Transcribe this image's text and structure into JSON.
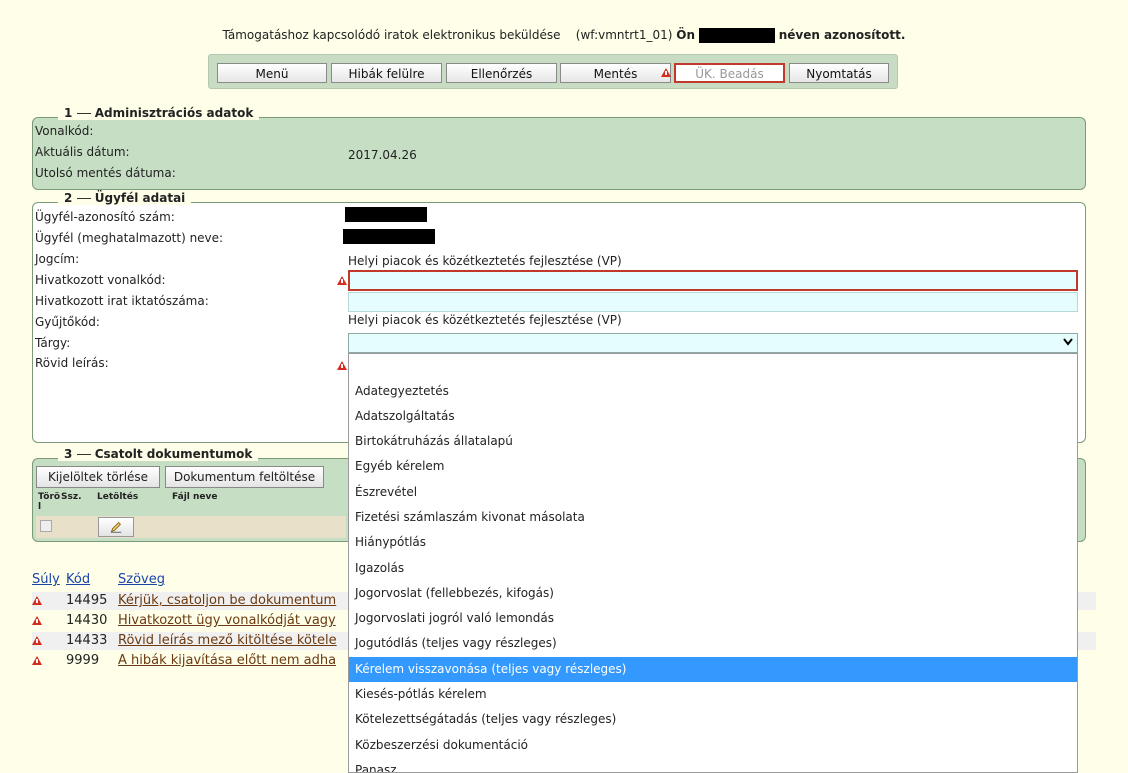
{
  "header": {
    "title": "Támogatáshoz kapcsolódó iratok elektronikus beküldése",
    "code": "(wf:vmntrt1_01)",
    "on": "Ön",
    "identified": "néven azonosított."
  },
  "toolbar": {
    "menu": "Menü",
    "errors_top": "Hibák felülre",
    "check": "Ellenőrzés",
    "save": "Mentés",
    "submit": "ÜK. Beadás",
    "print": "Nyomtatás"
  },
  "section1": {
    "num": "1",
    "title": "Adminisztrációs adatok",
    "barcode_label": "Vonalkód:",
    "date_label": "Aktuális dátum:",
    "date_value": "2017.04.26",
    "lastsave_label": "Utolsó mentés dátuma:"
  },
  "section2": {
    "num": "2",
    "title": "Ügyfél adatai",
    "client_id_label": "Ügyfél-azonosító szám:",
    "client_name_label": "Ügyfél (meghatalmazott) neve:",
    "jogcim_label": "Jogcím:",
    "jogcim_value": "Helyi piacok és közétkeztetés fejlesztése (VP)",
    "ref_barcode_label": "Hivatkozott vonalkód:",
    "ref_reg_label": "Hivatkozott irat iktatószáma:",
    "gyujto_label": "Gyűjtőkód:",
    "gyujto_value": "Helyi piacok és közétkeztetés fejlesztése (VP)",
    "targy_label": "Tárgy:",
    "rovid_label": "Rövid leírás:"
  },
  "section3": {
    "num": "3",
    "title": "Csatolt dokumentumok",
    "delete_btn": "Kijelöltek törlése",
    "upload_btn": "Dokumentum feltöltése",
    "col_del": "Törö l",
    "col_no": "Ssz.",
    "col_download": "Letöltés",
    "col_file": "Fájl neve"
  },
  "errors": {
    "h_weight": "Súly",
    "h_code": "Kód",
    "h_text": "Szöveg",
    "rows": [
      {
        "code": "14495",
        "text": "Kérjük, csatoljon be dokumentum"
      },
      {
        "code": "14430",
        "text": "Hivatkozott ügy vonalkódját vagy"
      },
      {
        "code": "14433",
        "text": "Rövid leírás mező kitöltése kötele"
      },
      {
        "code": "9999",
        "text": "A hibák kijavítása előtt nem adha"
      }
    ]
  },
  "dropdown": {
    "options": [
      "",
      "Adategyeztetés",
      "Adatszolgáltatás",
      "Birtokátruházás állatalapú",
      "Egyéb kérelem",
      "Észrevétel",
      "Fizetési számlaszám kivonat másolata",
      "Hiánypótlás",
      "Igazolás",
      "Jogorvoslat (fellebbezés, kifogás)",
      "Jogorvoslati jogról való lemondás",
      "Jogutódlás (teljes vagy részleges)",
      "Kérelem visszavonása (teljes vagy részleges)",
      "Kiesés-pótlás kérelem",
      "Kötelezettségátadás (teljes vagy részleges)",
      "Közbeszerzési dokumentáció",
      "Panasz"
    ],
    "selected_index": 12
  },
  "colors": {
    "background": "#fefee9",
    "panel_green": "#c6dfc4",
    "input_cyan": "#e6fdfd",
    "error_red": "#c0392b",
    "highlight": "#3399ff"
  }
}
